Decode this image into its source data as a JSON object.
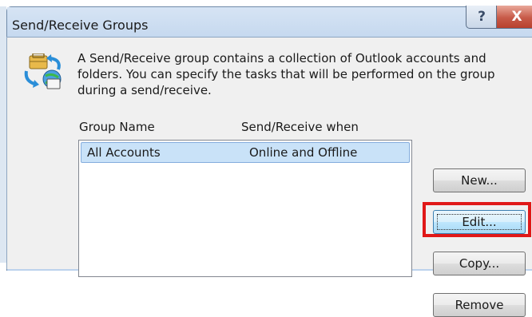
{
  "window": {
    "title": "Send/Receive Groups",
    "help_glyph": "?",
    "close_glyph": "X"
  },
  "description": "A Send/Receive group contains a collection of Outlook accounts and folders. You can specify the tasks that will be performed on the group during a send/receive.",
  "list": {
    "columns": [
      "Group Name",
      "Send/Receive when"
    ],
    "rows": [
      {
        "name": "All Accounts",
        "when": "Online and Offline"
      }
    ]
  },
  "buttons": {
    "new": "New...",
    "edit": "Edit...",
    "copy": "Copy...",
    "remove": "Remove"
  },
  "colors": {
    "highlight": "#e01818",
    "selection": "#c9e2f8"
  },
  "icons": {
    "group": "send-receive-groups-icon"
  }
}
